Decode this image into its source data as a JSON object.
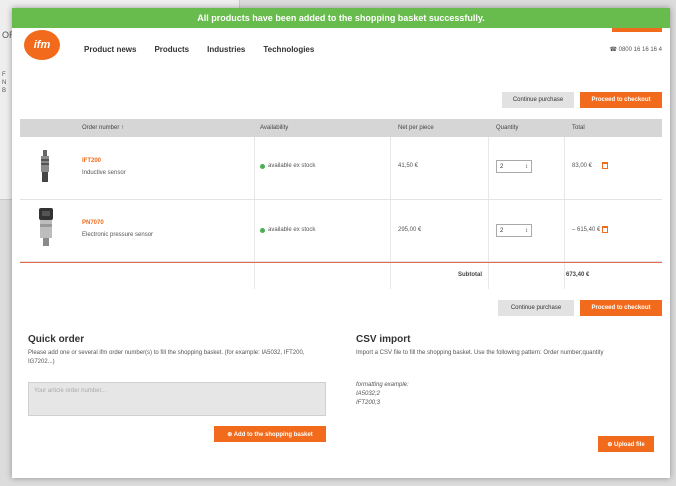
{
  "background_window": {
    "lines": [
      "OR",
      "F",
      "N",
      "B"
    ]
  },
  "banner": {
    "message": "All products have been added to the shopping basket successfully."
  },
  "header": {
    "logo_text": "ifm",
    "nav": [
      "Product news",
      "Products",
      "Industries",
      "Technologies"
    ],
    "phone": "☎ 0800 16 16 16 4"
  },
  "actions": {
    "continue_label": "Continue purchase",
    "proceed_label": "Proceed to checkout"
  },
  "table": {
    "headers": {
      "order": "Order number ↑",
      "availability": "Availability",
      "price": "Net per piece",
      "quantity": "Quantity",
      "total": "Total"
    },
    "rows": [
      {
        "code": "IFT200",
        "description": "Inductive sensor",
        "availability": "available ex stock",
        "price": "41,50 €",
        "quantity": "2",
        "total": "83,00 €"
      },
      {
        "code": "PN7070",
        "description": "Electronic pressure sensor",
        "availability": "available ex stock",
        "price": "295,00 €",
        "quantity": "2",
        "total": "– 615,40 €"
      }
    ],
    "subtotal_label": "Subtotal",
    "subtotal_value": "673,40 €"
  },
  "quick_order": {
    "title": "Quick order",
    "text": "Please add one or several ifm order number(s) to fill the shopping basket. (for example: IA5032, IFT200, IG7202...)",
    "placeholder": "Your article order number...",
    "button": "⊕ Add to the shopping basket"
  },
  "csv_import": {
    "title": "CSV import",
    "text": "Import a CSV file to fill the shopping basket. Use the following pattern: Order number;quantity",
    "example_label": "formatting example:",
    "example_lines": [
      "IA5032;2",
      "IFT200;3"
    ],
    "button": "⊕ Upload file"
  },
  "colors": {
    "accent": "#f26a1b",
    "success": "#68bb4d",
    "available": "#4caf50"
  }
}
